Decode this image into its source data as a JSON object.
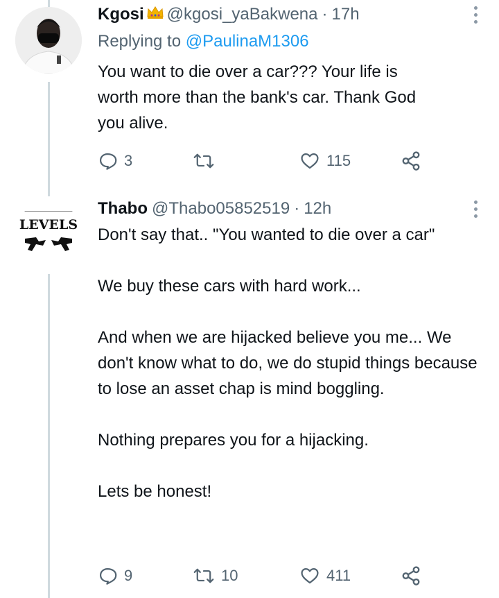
{
  "tweets": [
    {
      "name": "Kgosi",
      "handle": "@kgosi_yaBakwena",
      "separator": "·",
      "time": "17h",
      "replying_prefix": "Replying to",
      "replying_to": "@PaulinaM1306",
      "text_lines": [
        "You want to die over a car??? Your life is",
        "worth more than the bank's car. Thank God",
        "you alive."
      ],
      "replies": "3",
      "retweets": "",
      "likes": "115"
    },
    {
      "name": "Thabo",
      "handle": "@Thabo05852519",
      "separator": "·",
      "time": "12h",
      "avatar_text": "LEVELS",
      "paragraphs": [
        "Don't say that.. \"You wanted to die over a car\"",
        "We buy these cars with hard work...",
        "And when we are hijacked believe you me... We don't know what to do, we do stupid things because to lose an asset chap is mind boggling.",
        "Nothing prepares you for a hijacking.",
        "Lets be honest!"
      ],
      "replies": "9",
      "retweets": "10",
      "likes": "411"
    }
  ],
  "icons": {
    "reply": "reply-icon",
    "retweet": "retweet-icon",
    "like": "heart-icon",
    "share": "share-icon",
    "more": "more-vertical-icon",
    "crown": "crown-emoji-icon"
  },
  "colors": {
    "text": "#0f1419",
    "secondary": "#536471",
    "link": "#1d9bf0",
    "thread_line": "#cfd9de"
  }
}
